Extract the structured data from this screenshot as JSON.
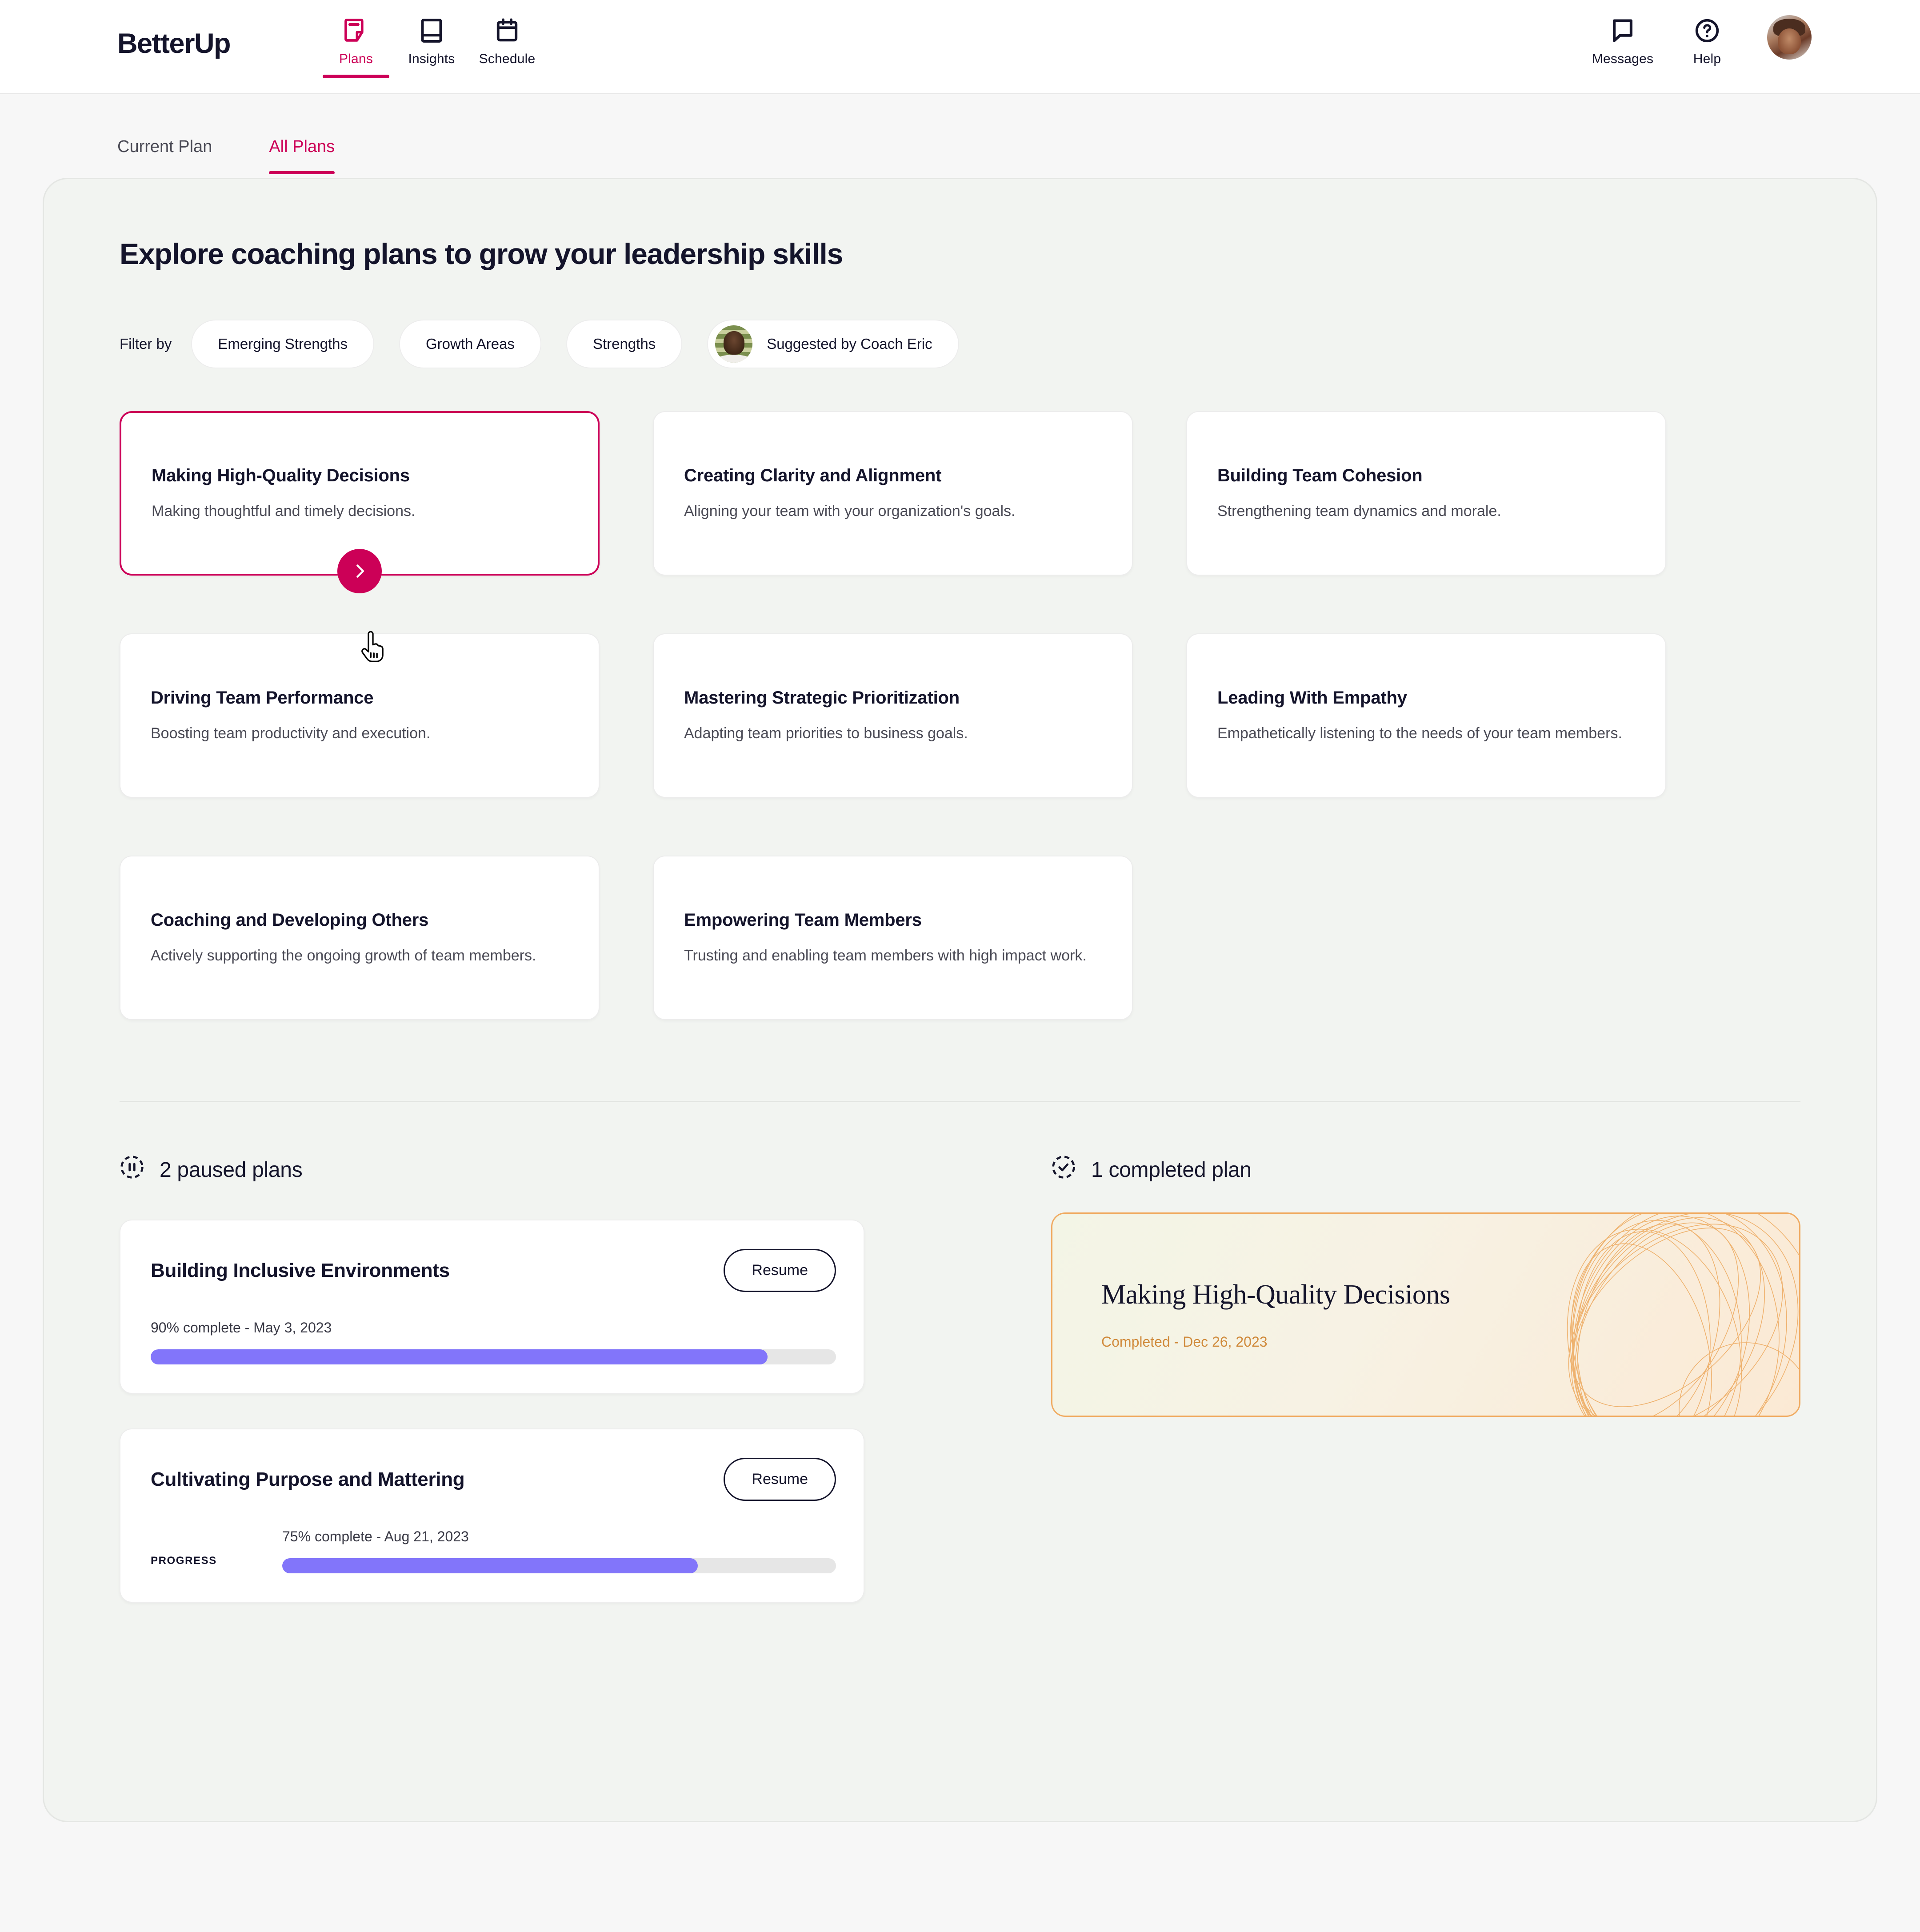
{
  "brand": "BetterUp",
  "nav": {
    "items": [
      {
        "label": "Plans",
        "icon": "note-plan-icon",
        "active": true
      },
      {
        "label": "Insights",
        "icon": "book-insights-icon",
        "active": false
      },
      {
        "label": "Schedule",
        "icon": "calendar-schedule-icon",
        "active": false
      }
    ],
    "right": [
      {
        "label": "Messages",
        "icon": "chat-bubble-icon"
      },
      {
        "label": "Help",
        "icon": "question-circle-icon"
      }
    ],
    "avatar_alt": "user-avatar"
  },
  "subtabs": [
    {
      "label": "Current Plan",
      "active": false
    },
    {
      "label": "All Plans",
      "active": true
    }
  ],
  "main": {
    "title": "Explore coaching plans to grow your leadership skills",
    "filter_label": "Filter by",
    "filters": [
      {
        "label": "Emerging Strengths",
        "avatar": false
      },
      {
        "label": "Growth Areas",
        "avatar": false
      },
      {
        "label": "Strengths",
        "avatar": false
      },
      {
        "label": "Suggested by Coach Eric",
        "avatar": true
      }
    ],
    "plans": [
      {
        "title": "Making High-Quality Decisions",
        "desc": "Making thoughtful and timely decisions.",
        "selected": true
      },
      {
        "title": "Creating Clarity and Alignment",
        "desc": "Aligning your team with your organization's goals.",
        "selected": false
      },
      {
        "title": "Building Team Cohesion",
        "desc": "Strengthening team dynamics and morale.",
        "selected": false
      },
      {
        "title": "Driving Team Performance",
        "desc": "Boosting team productivity and execution.",
        "selected": false
      },
      {
        "title": "Mastering Strategic Prioritization",
        "desc": "Adapting team priorities to business goals.",
        "selected": false
      },
      {
        "title": "Leading With Empathy",
        "desc": "Empathetically listening to the needs of your team members.",
        "selected": false
      },
      {
        "title": "Coaching and Developing Others",
        "desc": "Actively supporting the ongoing growth of team members.",
        "selected": false
      },
      {
        "title": "Empowering Team Members",
        "desc": "Trusting and enabling team members with high impact work.",
        "selected": false
      }
    ]
  },
  "paused": {
    "heading": "2 paused plans",
    "icon": "pause-circle-dashed-icon",
    "cards": [
      {
        "title": "Building Inclusive Environments",
        "button": "Resume",
        "progress_label": "",
        "caption": "90% complete - May 3, 2023",
        "percent": 90
      },
      {
        "title": "Cultivating Purpose and Mattering",
        "button": "Resume",
        "progress_label": "PROGRESS",
        "caption": "75% complete - Aug 21, 2023",
        "percent": 75
      }
    ]
  },
  "completed": {
    "heading": "1 completed plan",
    "icon": "check-circle-dashed-icon",
    "card": {
      "title": "Making High-Quality Decisions",
      "date": "Completed - Dec 26, 2023"
    }
  },
  "colors": {
    "accent": "#CC0057",
    "progress": "#8275FA",
    "completed_border": "#F0AB62",
    "completed_text": "#D08A3B",
    "ink": "#14142B"
  }
}
